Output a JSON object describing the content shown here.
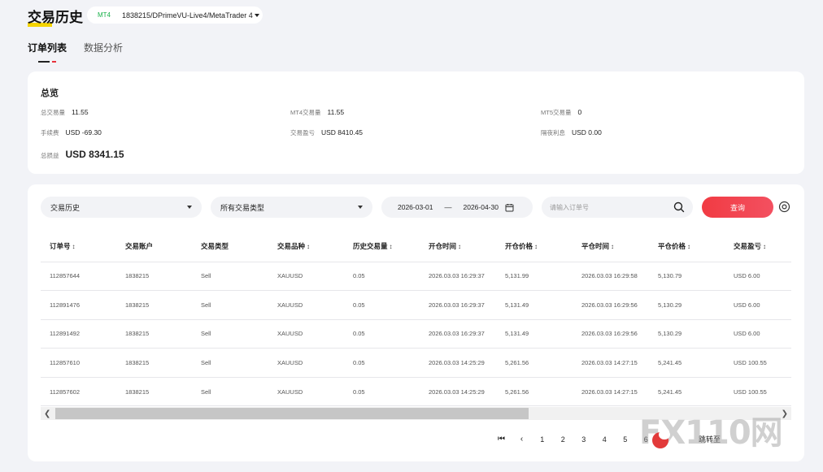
{
  "header": {
    "title": "交易历史",
    "platform_tag": "MT4",
    "account_label": "1838215/DPrimeVU-Live4/MetaTrader 4"
  },
  "tabs": [
    {
      "label": "订单列表",
      "active": true
    },
    {
      "label": "数据分析",
      "active": false
    }
  ],
  "overview": {
    "title": "总览",
    "total_volume_label": "总交易量",
    "total_volume": "11.55",
    "mt4_volume_label": "MT4交易量",
    "mt4_volume": "11.55",
    "mt5_volume_label": "MT5交易量",
    "mt5_volume": "0",
    "fee_label": "手续费",
    "fee": "USD -69.30",
    "trade_pnl_label": "交易盈亏",
    "trade_pnl": "USD 8410.45",
    "swap_label": "隔夜利息",
    "swap": "USD 0.00",
    "total_pnl_label": "总损益",
    "total_pnl": "USD 8341.15"
  },
  "filters": {
    "history_select": "交易历史",
    "type_select": "所有交易类型",
    "date_from": "2026-03-01",
    "date_sep": "—",
    "date_to": "2026-04-30",
    "order_search_placeholder": "请输入订单号",
    "query_label": "查询"
  },
  "table": {
    "columns": [
      {
        "label": "订单号",
        "sortable": true
      },
      {
        "label": "交易账户",
        "sortable": false
      },
      {
        "label": "交易类型",
        "sortable": false
      },
      {
        "label": "交易品种",
        "sortable": true
      },
      {
        "label": "历史交易量",
        "sortable": true
      },
      {
        "label": "开仓时间",
        "sortable": true
      },
      {
        "label": "开仓价格",
        "sortable": true
      },
      {
        "label": "平仓时间",
        "sortable": true
      },
      {
        "label": "平仓价格",
        "sortable": true
      },
      {
        "label": "交易盈亏",
        "sortable": true
      }
    ],
    "rows": [
      [
        "112857644",
        "1838215",
        "Sell",
        "XAUUSD",
        "0.05",
        "2026.03.03 16:29:37",
        "5,131.99",
        "2026.03.03 16:29:58",
        "5,130.79",
        "USD 6.00"
      ],
      [
        "112891476",
        "1838215",
        "Sell",
        "XAUUSD",
        "0.05",
        "2026.03.03 16:29:37",
        "5,131.49",
        "2026.03.03 16:29:56",
        "5,130.29",
        "USD 6.00"
      ],
      [
        "112891492",
        "1838215",
        "Sell",
        "XAUUSD",
        "0.05",
        "2026.03.03 16:29:37",
        "5,131.49",
        "2026.03.03 16:29:56",
        "5,130.29",
        "USD 6.00"
      ],
      [
        "112857610",
        "1838215",
        "Sell",
        "XAUUSD",
        "0.05",
        "2026.03.03 14:25:29",
        "5,261.56",
        "2026.03.03 14:27:15",
        "5,241.45",
        "USD 100.55"
      ],
      [
        "112857602",
        "1838215",
        "Sell",
        "XAUUSD",
        "0.05",
        "2026.03.03 14:25:29",
        "5,261.56",
        "2026.03.03 14:27:15",
        "5,241.45",
        "USD 100.55"
      ]
    ],
    "sort_glyph": "↕"
  },
  "pagination": {
    "pages": [
      "1",
      "2",
      "3",
      "4",
      "5",
      "6"
    ],
    "jump_label": "跳转至"
  },
  "watermark": "FX110网",
  "colors": {
    "accent": "#f13b43",
    "mt4_tag": "#19b14a",
    "title_highlight": "#f5d400"
  }
}
